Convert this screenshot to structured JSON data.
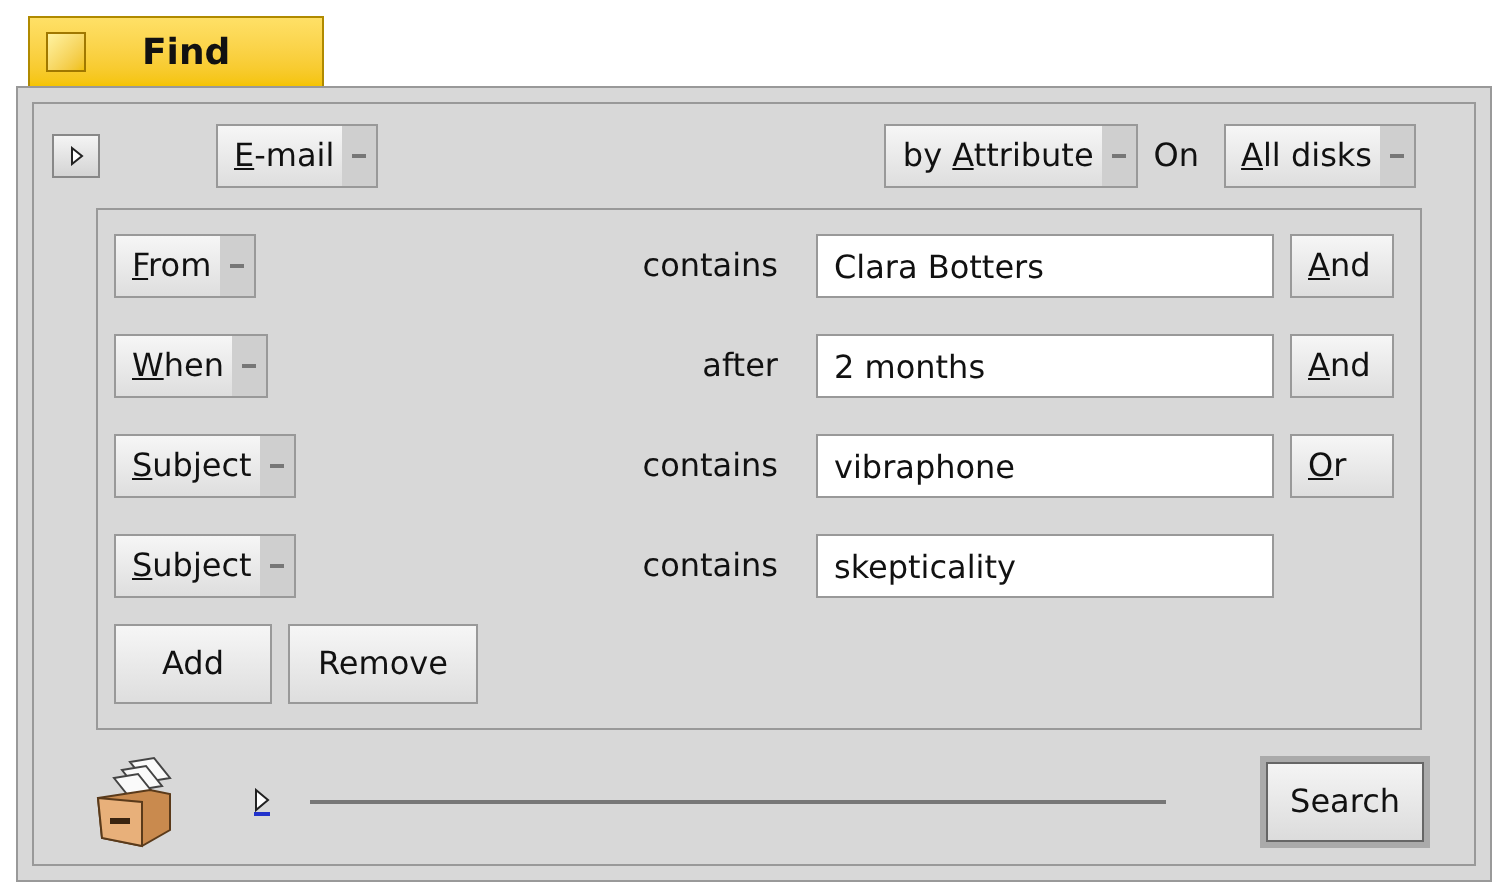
{
  "window": {
    "title": "Find"
  },
  "toolbar": {
    "type_menu": {
      "key": "E",
      "after": "-mail"
    },
    "method_menu": {
      "before": "by ",
      "key": "A",
      "after": "ttribute"
    },
    "volume_label": "On",
    "volume_menu": {
      "key": "A",
      "after": "ll disks"
    }
  },
  "criteria": [
    {
      "attribute": {
        "key": "F",
        "after": "rom"
      },
      "operator": "contains",
      "value": "Clara Botters",
      "connector": {
        "key": "A",
        "after": "nd"
      }
    },
    {
      "attribute": {
        "key": "W",
        "after": "hen"
      },
      "operator": "after",
      "value": "2 months",
      "connector": {
        "key": "A",
        "after": "nd"
      }
    },
    {
      "attribute": {
        "key": "S",
        "after": "ubject"
      },
      "operator": "contains",
      "value": "vibraphone",
      "connector": {
        "key": "O",
        "after": "r"
      }
    },
    {
      "attribute": {
        "key": "S",
        "after": "ubject"
      },
      "operator": "contains",
      "value": "skepticality"
    }
  ],
  "buttons": [
    "Add",
    "Remove"
  ],
  "search_button": "Search"
}
